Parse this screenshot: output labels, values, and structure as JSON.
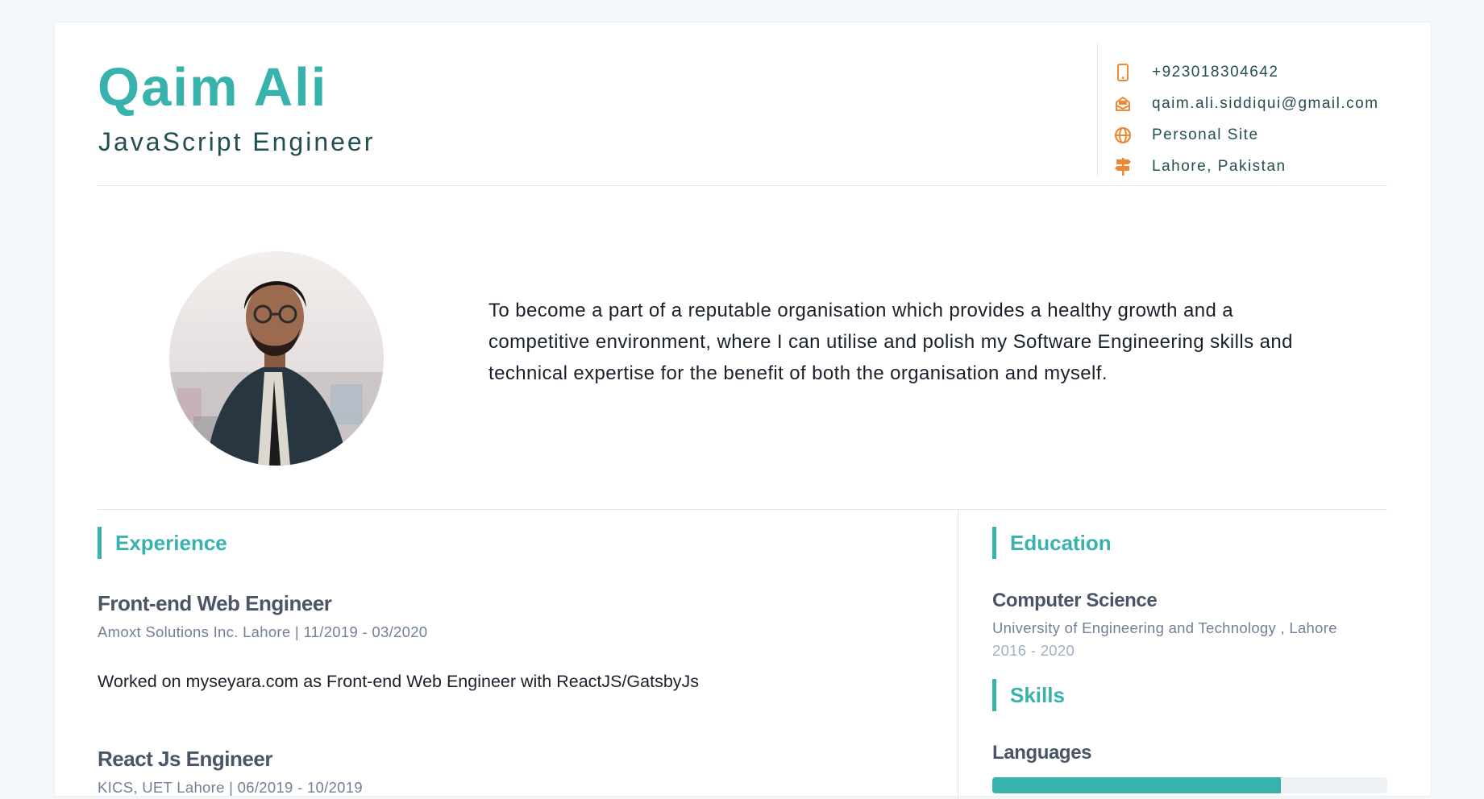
{
  "header": {
    "name": "Qaim Ali",
    "role": "JavaScript Engineer"
  },
  "contact": [
    {
      "icon": "mobile-phone-icon",
      "text": "+923018304642"
    },
    {
      "icon": "envelope-icon",
      "text": "qaim.ali.siddiqui@gmail.com"
    },
    {
      "icon": "globe-icon",
      "text": "Personal Site"
    },
    {
      "icon": "signpost-icon",
      "text": "Lahore, Pakistan"
    }
  ],
  "about": {
    "summary": "To become a part of a reputable organisation which provides a healthy growth and a competitive environment, where I can utilise and polish my Software Engineering skills and technical expertise for the benefit of both the organisation and myself."
  },
  "experience": {
    "title": "Experience",
    "jobs": [
      {
        "title": "Front-end Web Engineer",
        "meta": "Amoxt Solutions Inc. Lahore | 11/2019 - 03/2020",
        "description": "Worked on myseyara.com as Front-end Web Engineer with ReactJS/GatsbyJs"
      },
      {
        "title": "React Js Engineer",
        "meta": "KICS, UET Lahore | 06/2019 - 10/2019"
      }
    ]
  },
  "education": {
    "title": "Education",
    "degree": "Computer Science",
    "school": "University of Engineering and Technology , Lahore",
    "years": "2016 - 2020"
  },
  "skills": {
    "title": "Skills",
    "categories": [
      {
        "name": "Languages",
        "level": 0.73
      }
    ]
  },
  "colors": {
    "accent": "#38b2ac",
    "icon": "#ed8936",
    "heading": "#4a5568",
    "muted": "#718096"
  }
}
